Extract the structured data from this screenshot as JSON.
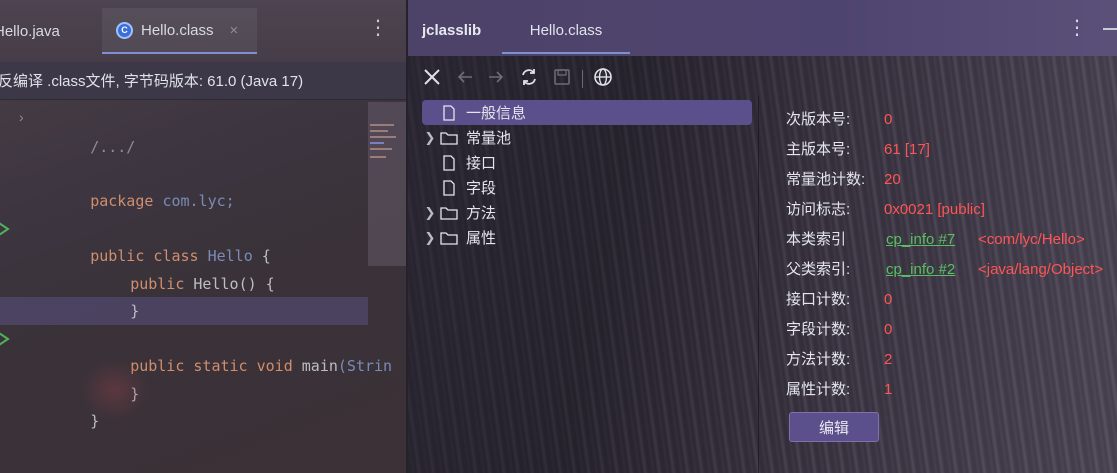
{
  "editor": {
    "tabs": [
      {
        "label": "Hello.java"
      },
      {
        "label": "Hello.class"
      }
    ],
    "close_glyph": "×",
    "menu_glyph": "⋮",
    "banner": "反编译 .class文件, 字节码版本: 61.0 (Java 17)",
    "code": {
      "fold": "›",
      "import_comment": "/.../",
      "package_kw": "package",
      "package_name": "com.lyc",
      "semicolon": ";",
      "public_kw": "public",
      "class_kw": "class",
      "class_name": "Hello",
      "open_brace": "{",
      "ctor_name": "Hello",
      "ctor_parens": "() {",
      "close_brace": "}",
      "static_kw": "static",
      "void_kw": "void",
      "main_name": "main",
      "main_args": "(Strin"
    }
  },
  "jclasslib": {
    "title": "jclasslib",
    "tab": "Hello.class",
    "menu_glyph": "⋮",
    "toolbar_icons": [
      "close-icon",
      "back-icon",
      "forward-icon",
      "refresh-icon",
      "save-icon",
      "globe-icon"
    ],
    "tree": [
      {
        "label": "一般信息",
        "expandable": false,
        "selected": true
      },
      {
        "label": "常量池",
        "expandable": true,
        "selected": false
      },
      {
        "label": "接口",
        "expandable": false,
        "selected": false
      },
      {
        "label": "字段",
        "expandable": false,
        "selected": false
      },
      {
        "label": "方法",
        "expandable": true,
        "selected": false
      },
      {
        "label": "属性",
        "expandable": true,
        "selected": false
      }
    ],
    "general_info": {
      "minor_version": {
        "label": "次版本号:",
        "value": "0"
      },
      "major_version": {
        "label": "主版本号:",
        "value": "61 [17]"
      },
      "constant_pool_count": {
        "label": "常量池计数:",
        "value": "20"
      },
      "access_flags": {
        "label": "访问标志:",
        "value": "0x0021 [public]"
      },
      "this_class": {
        "label": "本类索引",
        "link": "cp_info #7",
        "value": "<com/lyc/Hello>"
      },
      "super_class": {
        "label": "父类索引:",
        "link": "cp_info #2",
        "value": "<java/lang/Object>"
      },
      "interfaces_count": {
        "label": "接口计数:",
        "value": "0"
      },
      "fields_count": {
        "label": "字段计数:",
        "value": "0"
      },
      "methods_count": {
        "label": "方法计数:",
        "value": "2"
      },
      "attributes_count": {
        "label": "属性计数:",
        "value": "1"
      }
    },
    "edit_button": "编辑",
    "colors": {
      "value": "#ff5555",
      "link": "#58c060",
      "selection": "#5b4f8c"
    }
  }
}
